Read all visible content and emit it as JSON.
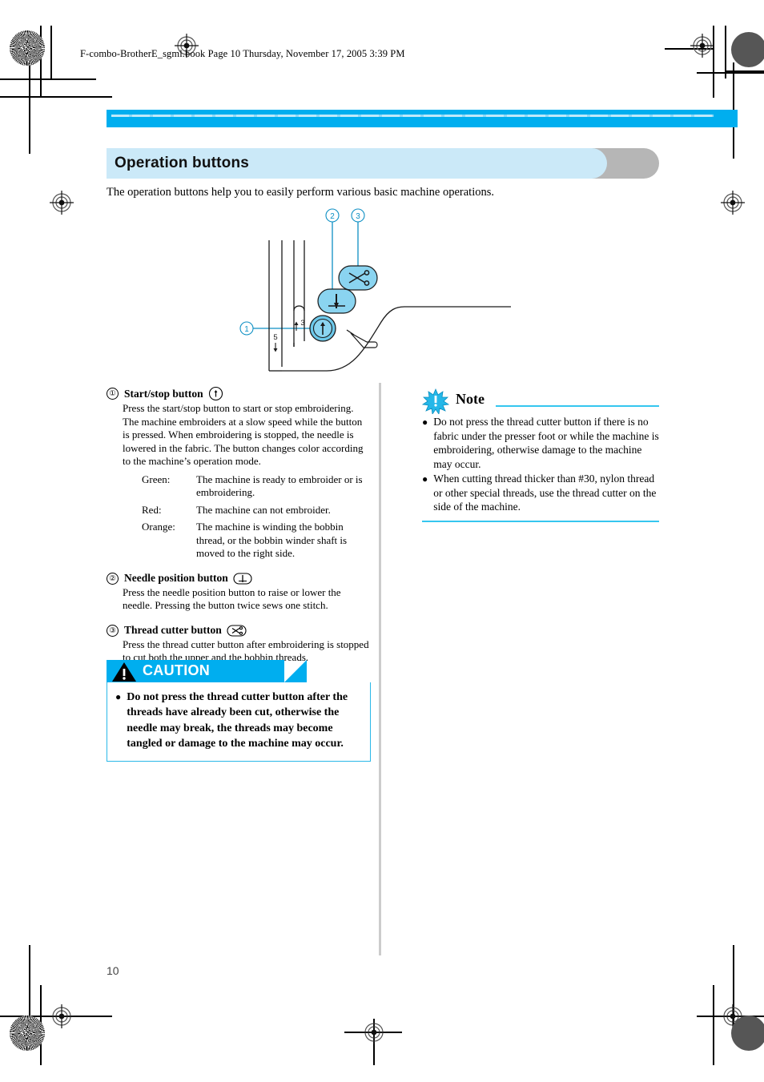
{
  "running_header": "F-combo-BrotherE_sgml.book  Page 10  Thursday, November 17, 2005  3:39 PM",
  "page_number": "10",
  "colors": {
    "cyan_rule": "#00AEEF",
    "heading_fill": "#cbe9f8",
    "heading_shadow": "#b6b6b6",
    "note_rule": "#35c6ef",
    "caution_banner": "#00AEEF",
    "button_fill": "#8ad4f0",
    "diagram_line": "#1a1a1a"
  },
  "heading": {
    "title": "Operation buttons"
  },
  "intro": "The operation buttons help you to easily perform various basic machine operations.",
  "illustration": {
    "callouts": [
      {
        "id": "1",
        "label": "①"
      },
      {
        "id": "2",
        "label": "②"
      },
      {
        "id": "3",
        "label": "③"
      }
    ],
    "scale_marks": [
      {
        "value": "5",
        "direction": "down"
      },
      {
        "value": "3",
        "direction": "up"
      }
    ],
    "buttons": [
      {
        "name": "start-stop-button",
        "icon": "up-arrow-icon",
        "shape": "circle"
      },
      {
        "name": "needle-position-button",
        "icon": "needle-down-icon",
        "shape": "rounded-rect"
      },
      {
        "name": "thread-cutter-button",
        "icon": "scissors-icon",
        "shape": "rounded-rect"
      }
    ]
  },
  "items": [
    {
      "num": "①",
      "title": "Start/stop button",
      "icon": "start-stop-icon",
      "body": "Press the start/stop button to start or stop embroidering. The machine embroiders at a slow speed while the button is pressed. When embroidering is stopped, the needle is lowered in the fabric.\nThe button changes color according to the machine’s operation mode.",
      "modes": [
        {
          "name": "Green:",
          "desc": "The machine is ready to embroider or is embroidering."
        },
        {
          "name": "Red:",
          "desc": "The machine can not embroider."
        },
        {
          "name": "Orange:",
          "desc": "The machine is winding the bobbin thread, or the bobbin winder shaft is moved to the right side."
        }
      ]
    },
    {
      "num": "②",
      "title": "Needle position button",
      "icon": "needle-position-icon",
      "body": "Press the needle position button to raise or lower the needle. Pressing the button twice sews one stitch.",
      "modes": []
    },
    {
      "num": "③",
      "title": "Thread cutter button",
      "icon": "thread-cutter-icon",
      "body": "Press the thread cutter button after embroidering is stopped to cut both the upper and the bobbin threads.",
      "modes": []
    }
  ],
  "caution": {
    "label": "CAUTION",
    "icon": "warning-triangle-icon",
    "bullets": [
      "Do not press the thread cutter button after the threads have already been cut, otherwise the needle may break, the threads may become tangled or damage to the machine may occur."
    ]
  },
  "note": {
    "title": "Note",
    "icon": "note-starburst-icon",
    "bullets": [
      "Do not press the thread cutter button if there is no fabric under the presser foot or while the machine is embroidering, otherwise damage to the machine may occur.",
      "When cutting thread thicker than #30, nylon thread or other special threads, use the thread cutter on the side of the machine."
    ]
  }
}
